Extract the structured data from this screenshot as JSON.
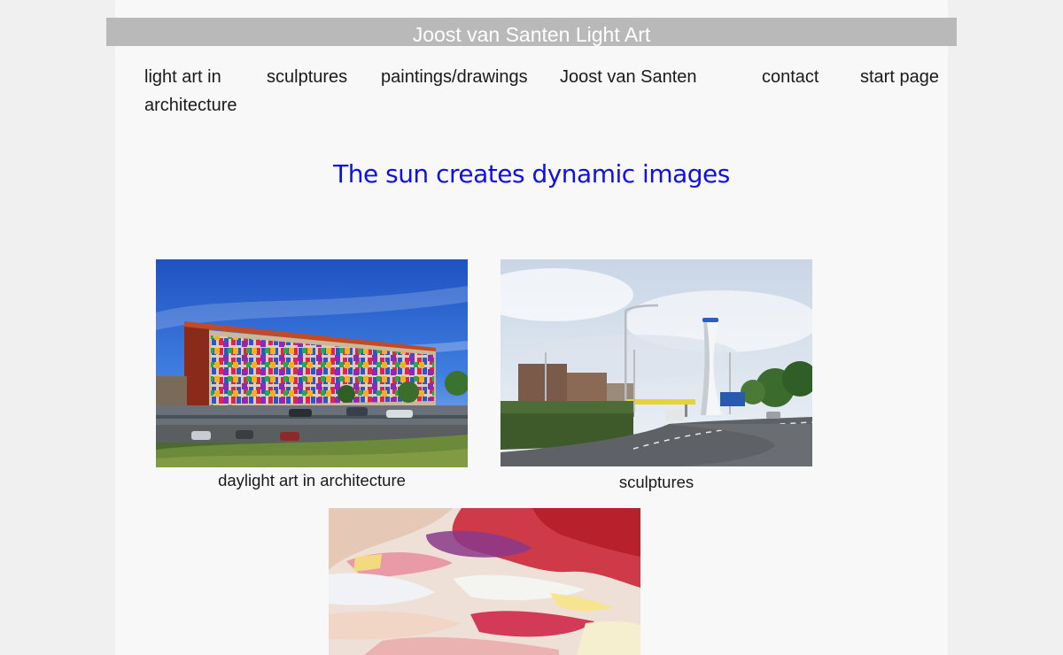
{
  "site": {
    "title": "Joost van Santen Light Art"
  },
  "nav": {
    "items": [
      {
        "line1": "light art in",
        "line2": "architecture"
      },
      {
        "label": "sculptures"
      },
      {
        "label": "paintings/drawings"
      },
      {
        "label": "Joost van Santen"
      },
      {
        "label": "contact"
      },
      {
        "label": "start page"
      }
    ]
  },
  "main": {
    "headline": "The sun creates dynamic images",
    "gallery": [
      {
        "caption": "daylight art in architecture",
        "image": "building-photo"
      },
      {
        "caption": "sculptures",
        "image": "sculpture-photo"
      },
      {
        "image": "painting-photo"
      }
    ]
  },
  "colors": {
    "page_background": "#f0f0f0",
    "content_background": "#f8f8f8",
    "banner_background": "#b9b9b9",
    "banner_text": "#ffffff",
    "headline": "#1111dd"
  }
}
